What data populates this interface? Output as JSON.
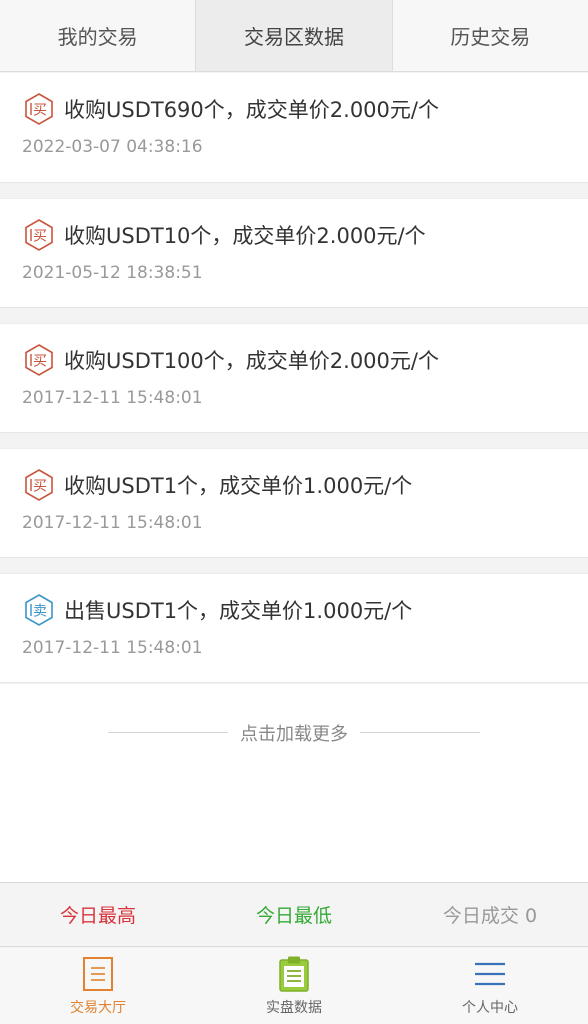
{
  "tabs": [
    {
      "label": "我的交易"
    },
    {
      "label": "交易区数据"
    },
    {
      "label": "历史交易"
    }
  ],
  "records": [
    {
      "badge": "买",
      "type": "buy",
      "text": "收购USDT690个，成交单价2.000元/个",
      "time": "2022-03-07 04:38:16"
    },
    {
      "badge": "买",
      "type": "buy",
      "text": "收购USDT10个，成交单价2.000元/个",
      "time": "2021-05-12 18:38:51"
    },
    {
      "badge": "买",
      "type": "buy",
      "text": "收购USDT100个，成交单价2.000元/个",
      "time": "2017-12-11 15:48:01"
    },
    {
      "badge": "买",
      "type": "buy",
      "text": "收购USDT1个，成交单价1.000元/个",
      "time": "2017-12-11 15:48:01"
    },
    {
      "badge": "卖",
      "type": "sell",
      "text": "出售USDT1个，成交单价1.000元/个",
      "time": "2017-12-11 15:48:01"
    }
  ],
  "load_more": "点击加载更多",
  "stats": {
    "high_label": "今日最高",
    "low_label": "今日最低",
    "deal_label": "今日成交 0"
  },
  "nav": [
    {
      "label": "交易大厅",
      "icon": "document-icon"
    },
    {
      "label": "实盘数据",
      "icon": "clipboard-icon"
    },
    {
      "label": "个人中心",
      "icon": "menu-icon"
    }
  ],
  "colors": {
    "buy": "#c8553d",
    "sell": "#3a95c8",
    "high": "#d9343b",
    "low": "#35a935",
    "nav_active": "#e0822f"
  }
}
